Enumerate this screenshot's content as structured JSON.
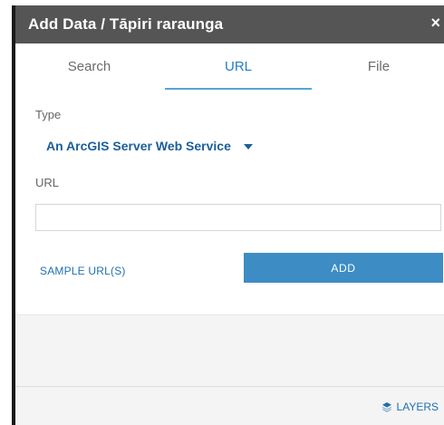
{
  "window": {
    "title": "Add Data / Tāpiri raraunga",
    "close_glyph": "×"
  },
  "tabs": [
    {
      "label": "Search",
      "active": false
    },
    {
      "label": "URL",
      "active": true
    },
    {
      "label": "File",
      "active": false
    }
  ],
  "form": {
    "type_label": "Type",
    "type_value": "An ArcGIS Server Web Service",
    "url_label": "URL",
    "url_value": "",
    "url_placeholder": ""
  },
  "actions": {
    "sample_label": "SAMPLE URL(S)",
    "add_label": "ADD"
  },
  "footer": {
    "layers_label": "LAYERS",
    "layers_icon": "layers-icon"
  },
  "colors": {
    "titlebar": "#555555",
    "accent": "#1f7dc4",
    "add_button": "#3d8cc4"
  }
}
